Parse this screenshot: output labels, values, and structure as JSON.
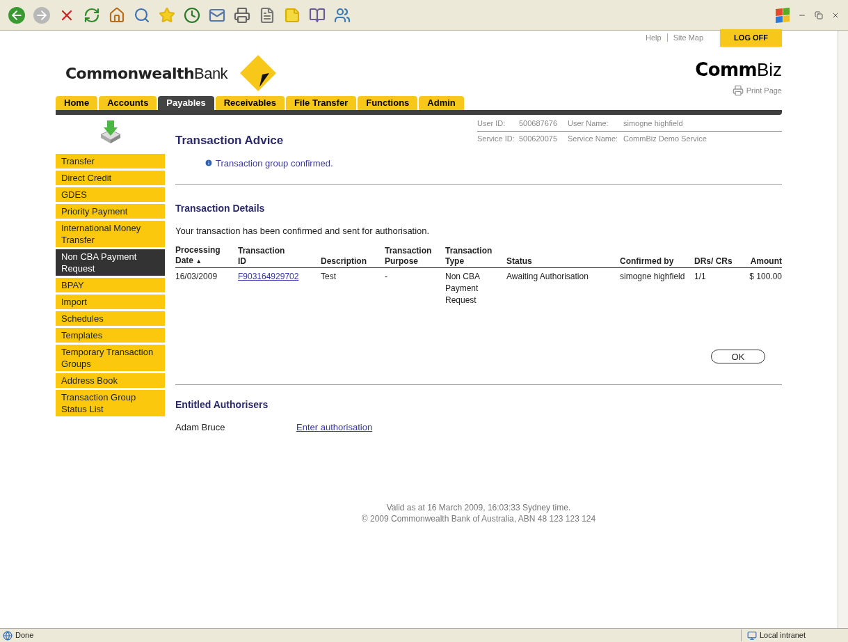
{
  "status_bar": {
    "left": "Done",
    "zone": "Local intranet"
  },
  "header": {
    "links": [
      "Help",
      "Site Map"
    ],
    "log_off": "LOG OFF",
    "logo_bold": "Commonwealth",
    "logo_regular": "Bank",
    "product_bold": "Comm",
    "product_regular": "Biz",
    "print": "Print Page"
  },
  "nav_tabs": [
    {
      "label": "Home",
      "selected": false
    },
    {
      "label": "Accounts",
      "selected": false
    },
    {
      "label": "Payables",
      "selected": true
    },
    {
      "label": "Receivables",
      "selected": false
    },
    {
      "label": "File Transfer",
      "selected": false
    },
    {
      "label": "Functions",
      "selected": false
    },
    {
      "label": "Admin",
      "selected": false
    }
  ],
  "user_info": [
    {
      "label": "User ID:",
      "value": "500687676",
      "name_label": "User Name:",
      "name_value": "simogne highfield"
    },
    {
      "label": "Service ID:",
      "value": "500620075",
      "name_label": "Service Name:",
      "name_value": "CommBiz Demo Service"
    }
  ],
  "sidebar": {
    "items": [
      {
        "label": "Transfer",
        "selected": false
      },
      {
        "label": "Direct Credit",
        "selected": false
      },
      {
        "label": "GDES",
        "selected": false
      },
      {
        "label": "Priority Payment",
        "selected": false
      },
      {
        "label": "International Money Transfer",
        "selected": false
      },
      {
        "label": "Non CBA Payment Request",
        "selected": true
      },
      {
        "label": "BPAY",
        "selected": false
      },
      {
        "label": "Import",
        "selected": false
      },
      {
        "label": "Schedules",
        "selected": false
      },
      {
        "label": "Templates",
        "selected": false
      },
      {
        "label": "Temporary Transaction Groups",
        "selected": false
      },
      {
        "label": "Address Book",
        "selected": false
      },
      {
        "label": "Transaction Group Status List",
        "selected": false
      }
    ]
  },
  "title": "Transaction Advice",
  "message": "Transaction group confirmed.",
  "details": {
    "heading": "Transaction Details",
    "text": "Your transaction has been confirmed and sent for authorisation.",
    "columns": [
      {
        "label": "Processing Date",
        "sort": "▲"
      },
      {
        "label": "Transaction ID"
      },
      {
        "label": "Description"
      },
      {
        "label": "Transaction Purpose"
      },
      {
        "label": "Transaction Type"
      },
      {
        "label": "Status"
      },
      {
        "label": "Confirmed by"
      },
      {
        "label": "DRs/ CRs"
      },
      {
        "label": "Amount"
      }
    ],
    "rows": [
      [
        {
          "kind": "text",
          "text": "16/03/2009"
        },
        {
          "kind": "link",
          "text": "F903164929702"
        },
        {
          "kind": "text",
          "text": "Test"
        },
        {
          "kind": "text",
          "text": "-"
        },
        {
          "kind": "text",
          "text": "Non CBA Payment Request"
        },
        {
          "kind": "text",
          "text": "Awaiting Authorisation"
        },
        {
          "kind": "text",
          "text": "simogne highfield"
        },
        {
          "kind": "text",
          "text": "1/1"
        },
        {
          "kind": "text",
          "text": "$ 100.00"
        }
      ]
    ]
  },
  "ok_button": "OK",
  "authorisers": {
    "heading": "Entitled Authorisers",
    "rows": [
      {
        "name": "Adam Bruce",
        "link": "Enter authorisation"
      }
    ]
  },
  "footer": [
    "Valid as at 16 March 2009, 16:03:33 Sydney time.",
    "© 2009 Commonwealth Bank of Australia, ABN 48 123 123 124"
  ]
}
